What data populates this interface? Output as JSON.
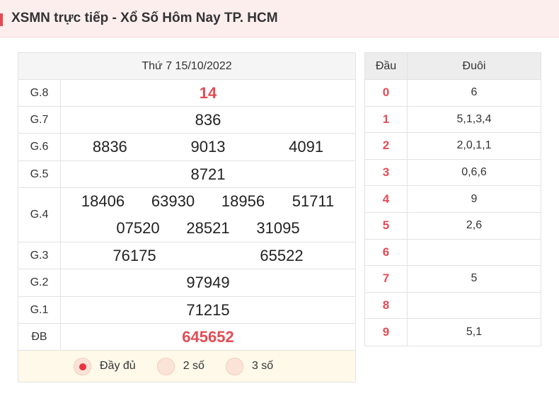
{
  "header": {
    "title": "XSMN trực tiếp - Xổ Số Hôm Nay TP. HCM"
  },
  "results": {
    "date": "Thứ 7 15/10/2022",
    "prizes": [
      {
        "label": "G.8",
        "numbers": [
          "14"
        ]
      },
      {
        "label": "G.7",
        "numbers": [
          "836"
        ]
      },
      {
        "label": "G.6",
        "numbers": [
          "8836",
          "9013",
          "4091"
        ]
      },
      {
        "label": "G.5",
        "numbers": [
          "8721"
        ]
      },
      {
        "label": "G.4",
        "numbers": [
          "18406",
          "63930",
          "18956",
          "51711",
          "07520",
          "28521",
          "31095"
        ]
      },
      {
        "label": "G.3",
        "numbers": [
          "76175",
          "65522"
        ]
      },
      {
        "label": "G.2",
        "numbers": [
          "97949"
        ]
      },
      {
        "label": "G.1",
        "numbers": [
          "71215"
        ]
      },
      {
        "label": "ĐB",
        "numbers": [
          "645652"
        ]
      }
    ],
    "options": [
      {
        "label": "Đầy đủ",
        "selected": true
      },
      {
        "label": "2 số",
        "selected": false
      },
      {
        "label": "3 số",
        "selected": false
      }
    ]
  },
  "loto": {
    "head_col": "Đầu",
    "tail_col": "Đuôi",
    "rows": [
      {
        "head": "0",
        "tail": "6"
      },
      {
        "head": "1",
        "tail": "5,1,3,4"
      },
      {
        "head": "2",
        "tail": "2,0,1,1"
      },
      {
        "head": "3",
        "tail": "0,6,6"
      },
      {
        "head": "4",
        "tail": "9"
      },
      {
        "head": "5",
        "tail": "2,6"
      },
      {
        "head": "6",
        "tail": ""
      },
      {
        "head": "7",
        "tail": "5"
      },
      {
        "head": "8",
        "tail": ""
      },
      {
        "head": "9",
        "tail": "5,1"
      }
    ]
  },
  "colors": {
    "accent": "#e34b54",
    "header_bg": "#fdeeee",
    "options_bg": "#fff9ea"
  }
}
